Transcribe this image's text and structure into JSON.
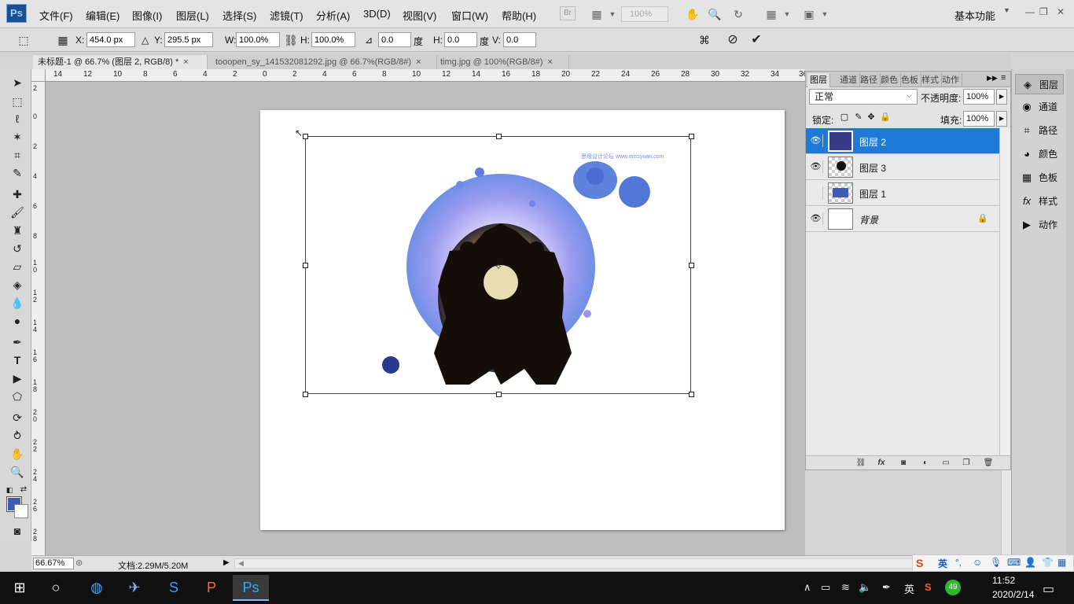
{
  "app": {
    "name": "Ps",
    "workspace": "基本功能"
  },
  "menu": [
    "文件(F)",
    "编辑(E)",
    "图像(I)",
    "图层(L)",
    "选择(S)",
    "滤镜(T)",
    "分析(A)",
    "3D(D)",
    "视图(V)",
    "窗口(W)",
    "帮助(H)"
  ],
  "menubar": {
    "zoom": "100%",
    "bridge": "Br"
  },
  "options": {
    "x_label": "X:",
    "x_value": "454.0 px",
    "y_label": "Y:",
    "y_value": "295.5 px",
    "w_label": "W:",
    "w_value": "100.0%",
    "h_label": "H:",
    "h_value": "100.0%",
    "angle_value": "0.0",
    "angle_unit": "度",
    "hskew_label": "H:",
    "hskew_value": "0.0",
    "hskew_unit": "度",
    "vskew_label": "V:",
    "vskew_value": "0.0"
  },
  "tabs": [
    {
      "label": "未标题-1 @ 66.7% (图层 2, RGB/8) *",
      "close": "×"
    },
    {
      "label": "tooopen_sy_141532081292.jpg @ 66.7%(RGB/8#)",
      "close": "×"
    },
    {
      "label": "timg.jpg @ 100%(RGB/8#)",
      "close": "×"
    }
  ],
  "ruler_top": [
    "14",
    "12",
    "10",
    "8",
    "6",
    "4",
    "2",
    "0",
    "2",
    "4",
    "6",
    "8",
    "10",
    "12",
    "14",
    "16",
    "18",
    "20",
    "22",
    "24",
    "26",
    "28",
    "30",
    "32",
    "34",
    "36"
  ],
  "ruler_left": [
    "2",
    "0",
    "2",
    "4",
    "6",
    "8",
    "10",
    "12",
    "14",
    "16",
    "18",
    "20",
    "22",
    "24",
    "26",
    "28"
  ],
  "canvas": {
    "watermark": "思缘设计论坛 www.missyuan.com"
  },
  "status": {
    "zoom": "66.67%",
    "doc_size": "文档:2.29M/5.20M"
  },
  "layers_panel": {
    "tabs": [
      "图层",
      "通道",
      "路径",
      "颜色",
      "色板",
      "样式",
      "动作"
    ],
    "blend_mode": "正常",
    "opacity_label": "不透明度:",
    "opacity_value": "100%",
    "lock_label": "锁定:",
    "fill_label": "填充:",
    "fill_value": "100%",
    "layers": [
      {
        "name": "图层 2",
        "visible": true,
        "selected": true
      },
      {
        "name": "图层 3",
        "visible": true,
        "selected": false
      },
      {
        "name": "图层 1",
        "visible": false,
        "selected": false
      },
      {
        "name": "背景",
        "visible": true,
        "selected": false
      }
    ]
  },
  "dock": [
    "图层",
    "通道",
    "路径",
    "颜色",
    "色板",
    "样式",
    "动作"
  ],
  "taskbar": {
    "time": "11:52",
    "date": "2020/2/14",
    "ime_lang": "英",
    "badge": "49"
  },
  "ime": {
    "lang": "英"
  },
  "colors": {
    "foreground": "#3f5bb3",
    "background": "#ffffff",
    "selection": "#1d7ad9"
  }
}
